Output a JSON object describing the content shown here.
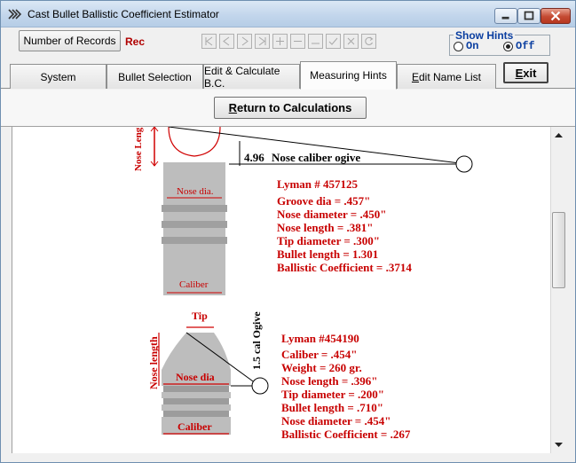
{
  "window": {
    "title": "Cast Bullet Ballistic Coefficient Estimator"
  },
  "toolbar": {
    "records_button": "Number of Records",
    "rec_label": "Rec",
    "show_hints": {
      "title": "Show Hints",
      "on": "On",
      "off": "Off",
      "selected": "off"
    }
  },
  "tabs": [
    {
      "label": "System",
      "active": false
    },
    {
      "label": "Bullet Selection",
      "active": false
    },
    {
      "label": "Edit & Calculate B.C.",
      "active": false
    },
    {
      "label": "Measuring Hints",
      "active": true
    },
    {
      "label_u": "E",
      "label_rest": "dit Name List",
      "active": false
    }
  ],
  "exit_button": {
    "u": "E",
    "rest": "xit"
  },
  "return_button": {
    "u": "R",
    "rest": "eturn to Calculations"
  },
  "diagram1": {
    "nose_length_label": "Nose Leng",
    "nose_dia_label": "Nose dia.",
    "caliber_label": "Caliber",
    "ogive_value": "4.96",
    "ogive_label": "Nose caliber ogive",
    "specs": [
      "Lyman # 457125",
      "Groove dia = .457\"",
      "Nose diameter = .450\"",
      "Nose length = .381\"",
      "Tip diameter = .300\"",
      "Bullet length = 1.301",
      "Ballistic Coefficient = .3714"
    ]
  },
  "diagram2": {
    "tip_label": "Tip",
    "nose_length_label": "Nose length",
    "nose_dia_label": "Nose dia",
    "caliber_label": "Caliber",
    "ogive_label": "1.5 cal Ogive",
    "specs": [
      "Lyman #454190",
      "Caliber  = .454\"",
      "Weight = 260 gr.",
      "Nose length = .396\"",
      "Tip diameter = .200\"",
      "Bullet length = .710\"",
      "Nose diameter = .454\"",
      "Ballistic Coefficient  = .267"
    ]
  },
  "colors": {
    "accent_red": "#c80000",
    "hint_blue": "#0a3ea0",
    "bullet_gray": "#bdbdbd"
  }
}
